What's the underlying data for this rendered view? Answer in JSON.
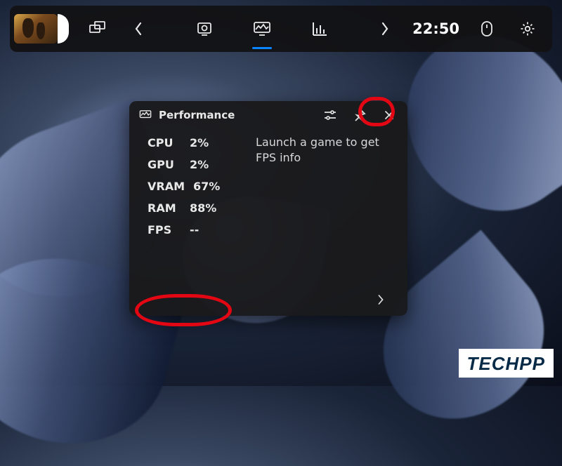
{
  "topbar": {
    "game_thumbnail": "game-art",
    "clock": "22:50",
    "active_tab_index": 1
  },
  "performance": {
    "title": "Performance",
    "info_text": "Launch a game to get FPS info",
    "metrics": [
      {
        "label": "CPU",
        "value": "2%"
      },
      {
        "label": "GPU",
        "value": "2%"
      },
      {
        "label": "VRAM",
        "value": "67%"
      },
      {
        "label": "RAM",
        "value": "88%"
      },
      {
        "label": "FPS",
        "value": "--"
      }
    ]
  },
  "watermark": {
    "text": "TECHPP"
  },
  "icons": {
    "widgets": "widgets-icon",
    "chevron_left": "chevron-left-icon",
    "chevron_right": "chevron-right-icon",
    "capture": "capture-icon",
    "perf_monitor": "performance-monitor-icon",
    "chart": "chart-icon",
    "mouse": "mouse-icon",
    "settings": "settings-gear-icon",
    "sliders": "sliders-icon",
    "pin": "pin-icon",
    "close": "close-icon"
  }
}
